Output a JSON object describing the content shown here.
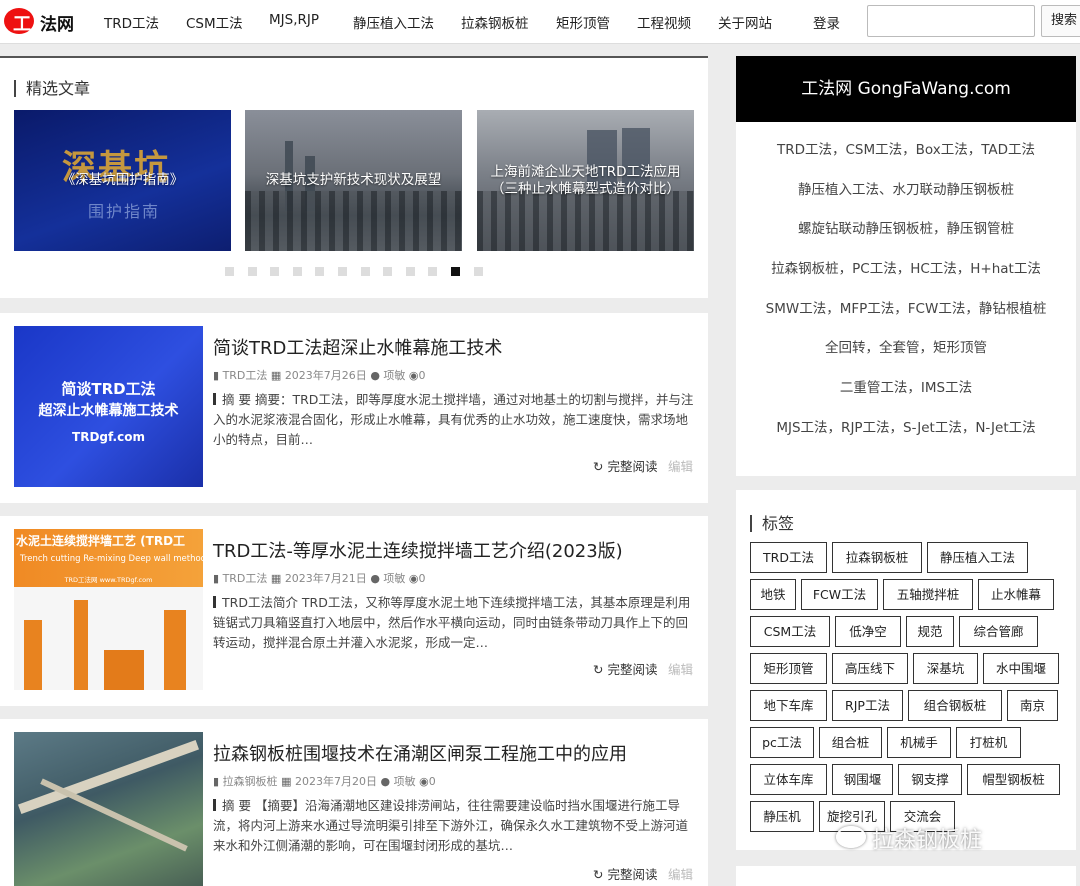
{
  "header": {
    "logo_text": "法网",
    "logo_mark": "工",
    "nav": [
      "TRD工法",
      "CSM工法",
      "MJS,RJP",
      "静压植入工法",
      "拉森钢板桩",
      "矩形顶管",
      "工程视频",
      "关于网站"
    ],
    "login_label": "登录",
    "search_placeholder": "",
    "search_button": "搜索"
  },
  "featured": {
    "title": "精选文章",
    "slides": [
      {
        "caption": "《深基坑围护指南》",
        "big": "深基坑",
        "small": "围护指南"
      },
      {
        "caption": "深基坑支护新技术现状及展望"
      },
      {
        "caption": "上海前滩企业天地TRD工法应用（三种止水帷幕型式造价对比）"
      }
    ],
    "dot_count": 12,
    "active_dot": 10
  },
  "articles": [
    {
      "title": "简谈TRD工法超深止水帷幕施工技术",
      "category": "TRD工法",
      "date": "2023年7月26日",
      "author": "项敏",
      "views": "0",
      "excerpt": "摘 要 摘要：TRD工法，即等厚度水泥土搅拌墙，通过对地基土的切割与搅拌，并与注入的水泥浆液混合固化，形成止水帷幕，具有优秀的止水功效，施工速度快，需求场地小的特点，目前…",
      "thumb_lines": [
        "简谈TRD工法",
        "超深止水帷幕施工技术",
        "TRDgf.com"
      ]
    },
    {
      "title": "TRD工法-等厚水泥土连续搅拌墙工艺介绍(2023版)",
      "category": "TRD工法",
      "date": "2023年7月21日",
      "author": "项敏",
      "views": "0",
      "excerpt": "TRD工法简介 TRD工法，又称等厚度水泥土地下连续搅拌墙工法，其基本原理是利用链锯式刀具箱竖直打入地层中，然后作水平横向运动，同时由链条带动刀具作上下的回转运动，搅拌混合原土并灌入水泥浆，形成一定…",
      "thumb_lines": [
        "水泥土连续搅拌墙工艺 (TRD工",
        "Trench cutting Re-mixing Deep wall method",
        "TRD工法网 www.TRDgf.com"
      ]
    },
    {
      "title": "拉森钢板桩围堰技术在涌潮区闸泵工程施工中的应用",
      "category": "拉森钢板桩",
      "date": "2023年7月20日",
      "author": "项敏",
      "views": "0",
      "excerpt": "摘 要 【摘要】沿海涌潮地区建设排涝闸站，往往需要建设临时挡水围堰进行施工导流，将内河上游来水通过导流明渠引排至下游外江，确保永久水工建筑物不受上游河道来水和外江侧涌潮的影响，可在围堰封闭形成的基坑…"
    }
  ],
  "read_more_label": "完整阅读",
  "edit_label": "编辑",
  "sidebar": {
    "banner": "工法网 GongFaWang.com",
    "links": [
      "TRD工法，CSM工法，Box工法，TAD工法",
      "静压植入工法、水刀联动静压钢板桩",
      "螺旋钻联动静压钢板桩，静压钢管桩",
      "拉森钢板桩，PC工法，HC工法，H+hat工法",
      "SMW工法，MFP工法，FCW工法，静钻根植桩",
      "全回转，全套管，矩形顶管",
      "二重管工法，IMS工法",
      "MJS工法，RJP工法，S-Jet工法，N-Jet工法"
    ],
    "tags_title": "标签",
    "tags": [
      [
        "TRD工法",
        "拉森钢板桩",
        "静压植入工法"
      ],
      [
        "地铁",
        "FCW工法",
        "五轴搅拌桩",
        "止水帷幕"
      ],
      [
        "CSM工法",
        "低净空",
        "规范",
        "综合管廊"
      ],
      [
        "矩形顶管",
        "高压线下",
        "深基坑",
        "水中围堰"
      ],
      [
        "地下车库",
        "RJP工法",
        "组合钢板桩",
        "南京"
      ],
      [
        "pc工法",
        "组合桩",
        "机械手",
        "打桩机"
      ],
      [
        "立体车库",
        "钢围堰",
        "钢支撑",
        "帽型钢板桩"
      ],
      [
        "静压机",
        "旋挖引孔",
        "交流会"
      ]
    ]
  },
  "watermark": "拉森钢板桩"
}
